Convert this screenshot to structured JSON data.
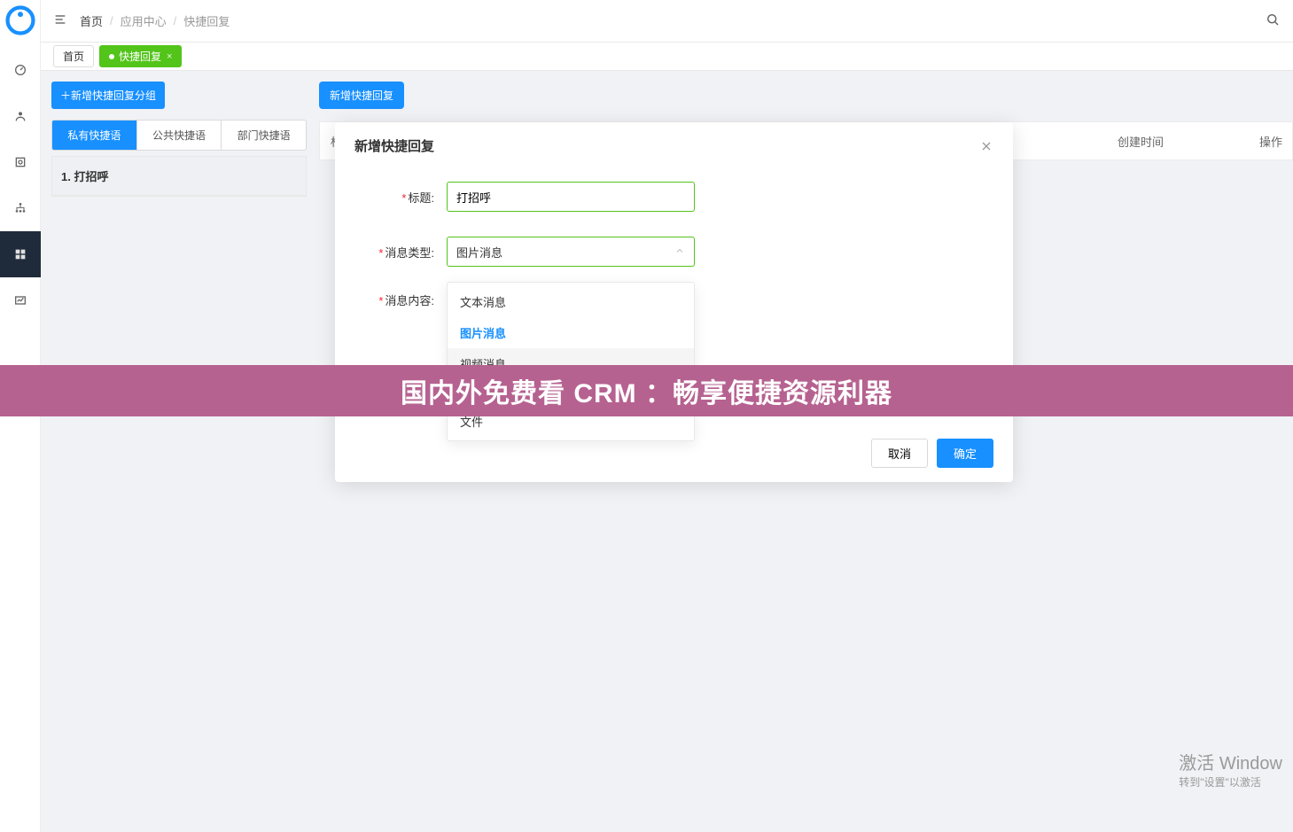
{
  "breadcrumb": {
    "home": "首页",
    "center": "应用中心",
    "current": "快捷回复"
  },
  "tabs": {
    "home": "首页",
    "quick": "快捷回复",
    "close": "×"
  },
  "leftpane": {
    "add_group": "＋新增快捷回复分组",
    "tabs": {
      "mine": "私有快捷语",
      "public": "公共快捷语",
      "dept": "部门快捷语"
    },
    "group1": "1. 打招呼"
  },
  "rightpane": {
    "new_reply": "新增快捷回复",
    "cols": {
      "title": "标题",
      "create_time": "创建时间",
      "action": "操作"
    }
  },
  "modal": {
    "title": "新增快捷回复",
    "label_title": "标题:",
    "value_title": "打招呼",
    "label_msgtype": "消息类型:",
    "value_msgtype": "图片消息",
    "label_content": "消息内容:",
    "options": {
      "text": "文本消息",
      "image": "图片消息",
      "video": "视频消息",
      "file": "文件"
    },
    "cancel": "取消",
    "ok": "确定"
  },
  "banner": "国内外免费看 CRM ：畅享便捷资源利器",
  "watermark": {
    "l1": "激活 Window",
    "l2": "转到\"设置\"以激活"
  }
}
